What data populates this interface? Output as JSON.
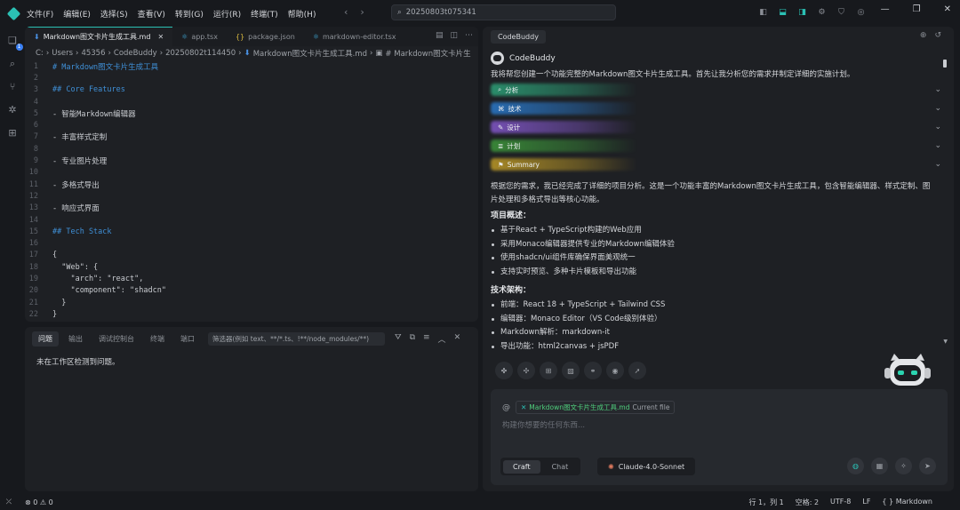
{
  "menu": [
    "文件(F)",
    "编辑(E)",
    "选择(S)",
    "查看(V)",
    "转到(G)",
    "运行(R)",
    "终端(T)",
    "帮助(H)"
  ],
  "search": {
    "value": "20250803t075341"
  },
  "activity_badge": "1",
  "editor": {
    "tabs": [
      {
        "label": "Markdown图文卡片生成工具.md",
        "icon": "markdown-icon",
        "active": true
      },
      {
        "label": "app.tsx",
        "icon": "react-icon"
      },
      {
        "label": "package.json",
        "icon": "json-icon"
      },
      {
        "label": "markdown-editor.tsx",
        "icon": "react-icon"
      }
    ],
    "breadcrumb": [
      "C:",
      "Users",
      "45356",
      "CodeBuddy",
      "20250802t114450",
      "Markdown图文卡片生成工具.md",
      "# Markdown图文卡片生"
    ],
    "lines": [
      {
        "n": "1",
        "text": "# Markdown图文卡片生成工具",
        "kind": "h"
      },
      {
        "n": "2",
        "text": "",
        "kind": "t"
      },
      {
        "n": "3",
        "text": "## Core Features",
        "kind": "h"
      },
      {
        "n": "4",
        "text": "",
        "kind": "t"
      },
      {
        "n": "5",
        "text": "- 智能Markdown编辑器",
        "kind": "t"
      },
      {
        "n": "6",
        "text": "",
        "kind": "t"
      },
      {
        "n": "7",
        "text": "- 丰富样式定制",
        "kind": "t"
      },
      {
        "n": "8",
        "text": "",
        "kind": "t"
      },
      {
        "n": "9",
        "text": "- 专业图片处理",
        "kind": "t"
      },
      {
        "n": "10",
        "text": "",
        "kind": "t"
      },
      {
        "n": "11",
        "text": "- 多格式导出",
        "kind": "t"
      },
      {
        "n": "12",
        "text": "",
        "kind": "t"
      },
      {
        "n": "13",
        "text": "- 响应式界面",
        "kind": "t"
      },
      {
        "n": "14",
        "text": "",
        "kind": "t"
      },
      {
        "n": "15",
        "text": "## Tech Stack",
        "kind": "h"
      },
      {
        "n": "16",
        "text": "",
        "kind": "t"
      },
      {
        "n": "17",
        "text": "{",
        "kind": "t"
      },
      {
        "n": "18",
        "text": "  \"Web\": {",
        "kind": "t"
      },
      {
        "n": "19",
        "text": "    \"arch\": \"react\",",
        "kind": "t"
      },
      {
        "n": "20",
        "text": "    \"component\": \"shadcn\"",
        "kind": "t"
      },
      {
        "n": "21",
        "text": "  }",
        "kind": "t"
      },
      {
        "n": "22",
        "text": "}",
        "kind": "t"
      }
    ]
  },
  "panel": {
    "tabs": [
      "问题",
      "输出",
      "调试控制台",
      "终端",
      "端口"
    ],
    "filter_placeholder": "筛选器(例如 text、**/*.ts、!**/node_modules/**)",
    "message": "未在工作区检测到问题。"
  },
  "chat": {
    "tab_label": "CodeBuddy",
    "bot_name": "CodeBuddy",
    "intro": "我将帮您创建一个功能完整的Markdown图文卡片生成工具。首先让我分析您的需求并制定详细的实施计划。",
    "sections": [
      {
        "label": "分析",
        "color": "#2ea97d",
        "icon": "search-icon"
      },
      {
        "label": "技术",
        "color": "#2b7fd6",
        "icon": "code-icon"
      },
      {
        "label": "设计",
        "color": "#8a5bd6",
        "icon": "brush-icon"
      },
      {
        "label": "计划",
        "color": "#3f9e3c",
        "icon": "list-icon"
      },
      {
        "label": "Summary",
        "color": "#c9a227",
        "icon": "bookmark-icon"
      }
    ],
    "analysis": "根据您的需求，我已经完成了详细的项目分析。这是一个功能丰富的Markdown图文卡片生成工具，包含智能编辑器、样式定制、图片处理和多格式导出等核心功能。",
    "overview_title": "项目概述：",
    "overview_items": [
      "基于React + TypeScript构建的Web应用",
      "采用Monaco编辑器提供专业的Markdown编辑体验",
      "使用shadcn/ui组件库确保界面美观统一",
      "支持实时预览、多种卡片模板和导出功能"
    ],
    "arch_title": "技术架构：",
    "arch_items": [
      "前端：React 18 + TypeScript + Tailwind CSS",
      "编辑器：Monaco Editor（VS Code级别体验）",
      "Markdown解析：markdown-it",
      "导出功能：html2canvas + jsPDF"
    ],
    "context_file": "Markdown图文卡片生成工具.md",
    "context_note": "Current file",
    "input_placeholder": "构建你想要的任何东西...",
    "modes": [
      "Craft",
      "Chat"
    ],
    "model": "Claude-4.0-Sonnet"
  },
  "status": {
    "problems": "⊗ 0 ⚠ 0",
    "position": "行 1，列 1",
    "spaces": "空格: 2",
    "encoding": "UTF-8",
    "eol": "LF",
    "language": "{ } Markdown"
  }
}
